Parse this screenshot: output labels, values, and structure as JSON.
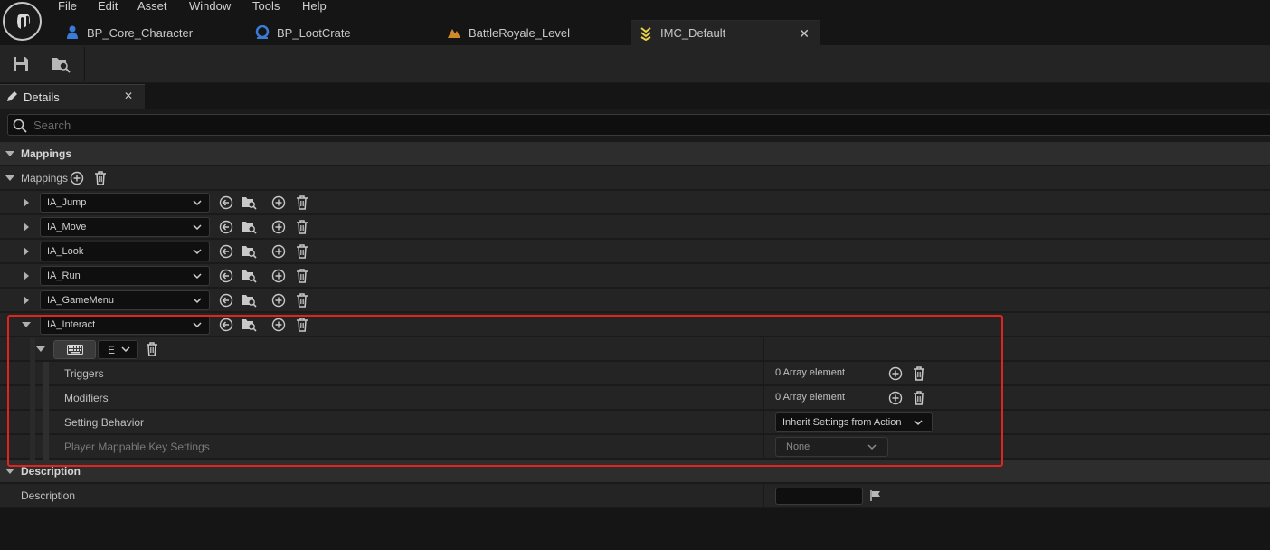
{
  "menu": [
    "File",
    "Edit",
    "Asset",
    "Window",
    "Tools",
    "Help"
  ],
  "tabs": [
    {
      "label": "BP_Core_Character",
      "icon": "blueprint-character-icon",
      "color": "#3a7bd5"
    },
    {
      "label": "BP_LootCrate",
      "icon": "blueprint-object-icon",
      "color": "#3a7bd5"
    },
    {
      "label": "BattleRoyale_Level",
      "icon": "level-icon",
      "color": "#d08a2a"
    },
    {
      "label": "IMC_Default",
      "icon": "input-mapping-context-icon",
      "color": "#e8d34a",
      "active": true
    }
  ],
  "toolbar": {
    "save": "save-icon",
    "browse": "browse-to-asset-icon"
  },
  "details": {
    "tab_label": "Details",
    "search_placeholder": "Search"
  },
  "sections": {
    "mappings_header": "Mappings",
    "mappings_array_label": "Mappings",
    "description_header": "Description",
    "description_label": "Description"
  },
  "mappings": [
    {
      "action": "IA_Jump",
      "expanded": false
    },
    {
      "action": "IA_Move",
      "expanded": false
    },
    {
      "action": "IA_Look",
      "expanded": false
    },
    {
      "action": "IA_Run",
      "expanded": false
    },
    {
      "action": "IA_GameMenu",
      "expanded": false
    },
    {
      "action": "IA_Interact",
      "expanded": true
    }
  ],
  "interact": {
    "key": "E",
    "key_icon": "keyboard-icon",
    "triggers_label": "Triggers",
    "triggers_value": "0 Array element",
    "modifiers_label": "Modifiers",
    "modifiers_value": "0 Array element",
    "setting_behavior_label": "Setting Behavior",
    "setting_behavior_value": "Inherit Settings from Action",
    "player_mappable_label": "Player Mappable Key Settings",
    "player_mappable_value": "None"
  },
  "colors": {
    "highlight": "#e0241f",
    "panel": "#242424",
    "category": "#2d2d2d"
  }
}
